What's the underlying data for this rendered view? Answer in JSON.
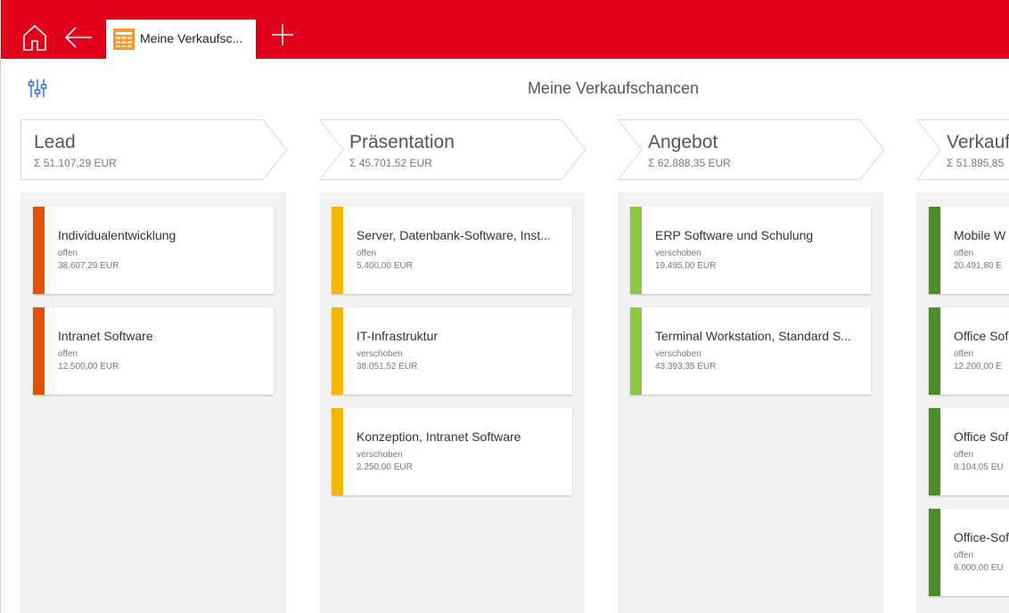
{
  "tab": {
    "label": "Meine Verkaufsc..."
  },
  "page": {
    "title": "Meine Verkaufschancen"
  },
  "colors": {
    "brand": "#e3001b",
    "lead": "#e35205",
    "presentation": "#f2b705",
    "offer": "#8dc63f",
    "sale": "#4c8a2b",
    "filter_icon": "#3a7bd5"
  },
  "icons": [
    "home-icon",
    "back-arrow-icon",
    "tab-table-icon",
    "plus-icon",
    "filter-settings-icon"
  ],
  "columns": [
    {
      "name": "Lead",
      "sum": "Σ 51.107,29 EUR",
      "cards": [
        {
          "title": "Individualentwicklung",
          "status": "offen",
          "amount": "38.607,29 EUR"
        },
        {
          "title": "Intranet Software",
          "status": "offen",
          "amount": "12.500,00 EUR"
        }
      ]
    },
    {
      "name": "Präsentation",
      "sum": "Σ 45.701,52 EUR",
      "cards": [
        {
          "title": "Server, Datenbank-Software, Inst...",
          "status": "offen",
          "amount": "5.400,00 EUR"
        },
        {
          "title": "IT-Infrastruktur",
          "status": "verschoben",
          "amount": "38.051,52 EUR"
        },
        {
          "title": "Konzeption, Intranet Software",
          "status": "verschoben",
          "amount": "2.250,00 EUR"
        }
      ]
    },
    {
      "name": "Angebot",
      "sum": "Σ 62.888,35 EUR",
      "cards": [
        {
          "title": "ERP Software und Schulung",
          "status": "verschoben",
          "amount": "19.495,00 EUR"
        },
        {
          "title": "Terminal Workstation, Standard S...",
          "status": "verschoben",
          "amount": "43.393,35 EUR"
        }
      ]
    },
    {
      "name": "Verkauf",
      "sum": "Σ 51.895,85",
      "cards": [
        {
          "title": "Mobile W",
          "status": "offen",
          "amount": "20.491,80 E"
        },
        {
          "title": "Office Sof",
          "status": "offen",
          "amount": "12.200,00 E"
        },
        {
          "title": "Office Sof",
          "status": "offen",
          "amount": "8.104,05 EU"
        },
        {
          "title": "Office-Sof",
          "status": "offen",
          "amount": "6.000,00 EU"
        }
      ]
    }
  ]
}
